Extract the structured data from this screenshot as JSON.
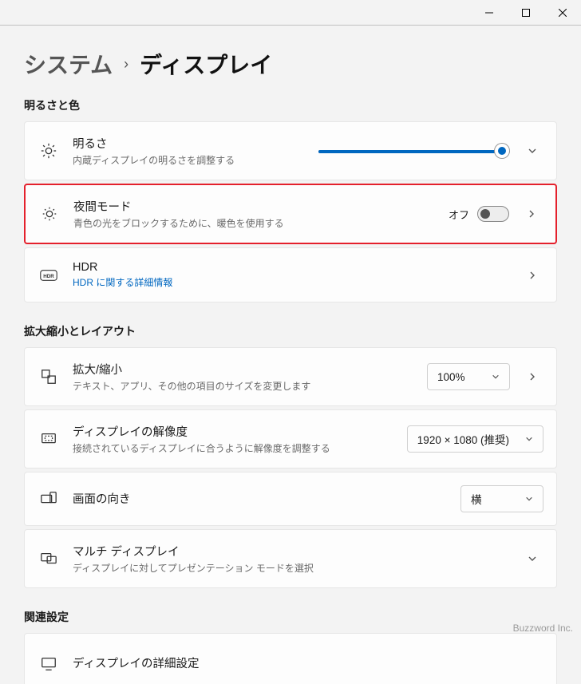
{
  "breadcrumb": {
    "root": "システム",
    "current": "ディスプレイ"
  },
  "sections": {
    "brightness_color": "明るさと色",
    "scale_layout": "拡大縮小とレイアウト",
    "related": "関連設定"
  },
  "brightness": {
    "title": "明るさ",
    "subtitle": "内蔵ディスプレイの明るさを調整する",
    "value_pct": 96
  },
  "night_light": {
    "title": "夜間モード",
    "subtitle": "青色の光をブロックするために、暖色を使用する",
    "state_label": "オフ",
    "on": false
  },
  "hdr": {
    "title": "HDR",
    "link": "HDR に関する詳細情報"
  },
  "scale": {
    "title": "拡大/縮小",
    "subtitle": "テキスト、アプリ、その他の項目のサイズを変更します",
    "value": "100%"
  },
  "resolution": {
    "title": "ディスプレイの解像度",
    "subtitle": "接続されているディスプレイに合うように解像度を調整する",
    "value": "1920 × 1080 (推奨)"
  },
  "orientation": {
    "title": "画面の向き",
    "value": "横"
  },
  "multi": {
    "title": "マルチ ディスプレイ",
    "subtitle": "ディスプレイに対してプレゼンテーション モードを選択"
  },
  "advanced": {
    "title": "ディスプレイの詳細設定"
  },
  "brand": "Buzzword Inc."
}
